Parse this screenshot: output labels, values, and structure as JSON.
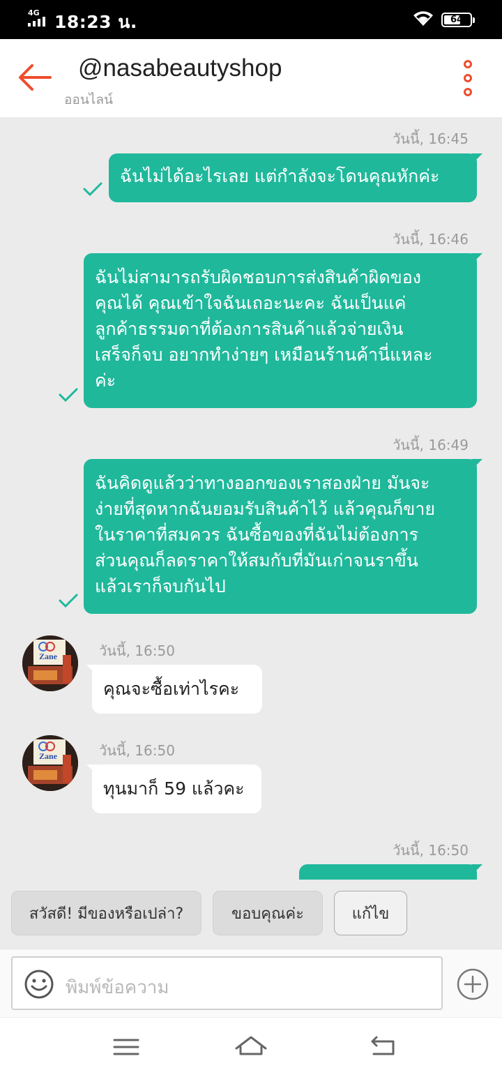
{
  "status_bar": {
    "network": "4G",
    "time": "18:23 น.",
    "battery": "64",
    "battery_level": 0.64,
    "icons": [
      "signal-icon",
      "wifi-icon",
      "battery-icon"
    ]
  },
  "header": {
    "title": "@nasabeautyshop",
    "status": "ออนไลน์",
    "icons": [
      "back-arrow-icon",
      "more-vertical-icon"
    ]
  },
  "messages": [
    {
      "direction": "outgoing",
      "time": "วันนี้, 16:45",
      "lines": [
        "ฉันไม่ได้อะไรเลย แต่กำลังจะโดนคุณหักค่ะ"
      ],
      "read": true
    },
    {
      "direction": "outgoing",
      "time": "วันนี้, 16:46",
      "lines": [
        "ฉันไม่สามารถรับผิดชอบการส่งสินค้าผิดของ",
        "คุณได้ คุณเข้าใจฉันเถอะนะคะ ฉันเป็นแค่",
        "ลูกค้าธรรมดาที่ต้องการสินค้าแล้วจ่ายเงิน",
        "เสร็จก็จบ อยากทำง่ายๆ เหมือนร้านค้านี่แหละ",
        "ค่ะ"
      ],
      "read": true
    },
    {
      "direction": "outgoing",
      "time": "วันนี้, 16:49",
      "lines": [
        "ฉันคิดดูแล้วว่าทางออกของเราสองฝ่าย มันจะ",
        "ง่ายที่สุดหากฉันยอมรับสินค้าไว้ แล้วคุณก็ขาย",
        "ในราคาที่สมควร ฉันซื้อของที่ฉันไม่ต้องการ",
        "ส่วนคุณก็ลดราคาให้สมกับที่มันเก่าจนราขึ้น",
        "แล้วเราก็จบกันไป"
      ],
      "read": true
    },
    {
      "direction": "incoming",
      "time": "วันนี้, 16:50",
      "lines": [
        "คุณจะซื้อเท่าไรคะ"
      ]
    },
    {
      "direction": "incoming",
      "time": "วันนี้, 16:50",
      "lines": [
        "ทุนมาก็ 59 แล้วคะ"
      ]
    },
    {
      "direction": "outgoing",
      "time": "วันนี้, 16:50",
      "lines": [],
      "partial": true
    }
  ],
  "avatar": {
    "label": "Zane",
    "icon": "shop-avatar-icon"
  },
  "quick_replies": [
    "สวัสดี! มีของหรือเปล่า?",
    "ขอบคุณค่ะ",
    "แก้ไข"
  ],
  "composer": {
    "placeholder": "พิมพ์ข้อความ",
    "icons": [
      "emoji-icon",
      "add-icon"
    ]
  },
  "nav_bar": {
    "icons": [
      "menu-icon",
      "home-icon",
      "back-icon"
    ]
  },
  "colors": {
    "accent": "#ee4d2d",
    "outgoing_bubble": "#1fb89b",
    "incoming_bubble": "#ffffff",
    "chat_background": "#ebebeb"
  }
}
